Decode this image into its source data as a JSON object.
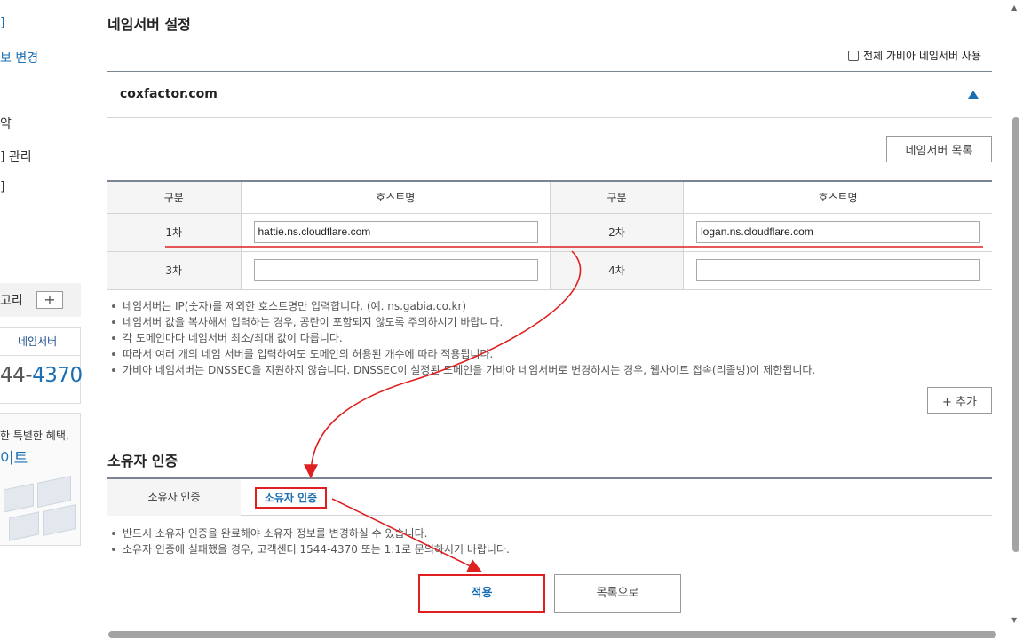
{
  "sidebar": {
    "links": [
      {
        "label": "]",
        "active": true
      },
      {
        "label": "보 변경",
        "active": true
      },
      {
        "label": "약",
        "active": false
      },
      {
        "label": "] 관리",
        "active": false
      },
      {
        "label": "]",
        "active": false
      }
    ],
    "category_label": "고리",
    "category_add": "+",
    "support_title": "네임서버",
    "support_phone_prefix": "44-",
    "support_phone_main": "4370",
    "banner_line1": "한 특별한 혜택,",
    "banner_line2": "이트"
  },
  "nameserver": {
    "title": "네임서버 설정",
    "use_gabia_label": "전체 가비아 네임서버 사용",
    "domain": "coxfactor.com",
    "list_button": "네임서버 목록",
    "table": {
      "header_type": "구분",
      "header_host": "호스트명",
      "rows": [
        {
          "left_label": "1차",
          "left_value": "hattie.ns.cloudflare.com",
          "right_label": "2차",
          "right_value": "logan.ns.cloudflare.com"
        },
        {
          "left_label": "3차",
          "left_value": "",
          "right_label": "4차",
          "right_value": ""
        }
      ]
    },
    "notes": [
      "네임서버는 IP(숫자)를 제외한 호스트명만 입력합니다. (예. ns.gabia.co.kr)",
      "네임서버 값을 복사해서 입력하는 경우, 공란이 포함되지 않도록 주의하시기 바랍니다.",
      "각 도메인마다 네임서버 최소/최대 값이 다릅니다.",
      "따라서 여러 개의 네임 서버를 입력하여도 도메인의 허용된 개수에 따라 적용됩니다.",
      "가비아 네임서버는 DNSSEC을 지원하지 않습니다. DNSSEC이 설정된 도메인을 가비아 네임서버로 변경하시는 경우, 웹사이트 접속(리졸빙)이 제한됩니다."
    ],
    "add_button": "+ 추가"
  },
  "owner": {
    "title": "소유자 인증",
    "row_label": "소유자 인증",
    "verify_button": "소유자 인증",
    "notes": [
      "반드시 소유자 인증을 완료해야 소유자 정보를 변경하실 수 있습니다.",
      "소유자 인증에 실패했을 경우, 고객센터 1544-4370 또는 1:1로 문의하시기 바랍니다."
    ]
  },
  "actions": {
    "apply": "적용",
    "back_to_list": "목록으로"
  },
  "colors": {
    "accent": "#1a6fb3",
    "annotation": "#e02020"
  }
}
